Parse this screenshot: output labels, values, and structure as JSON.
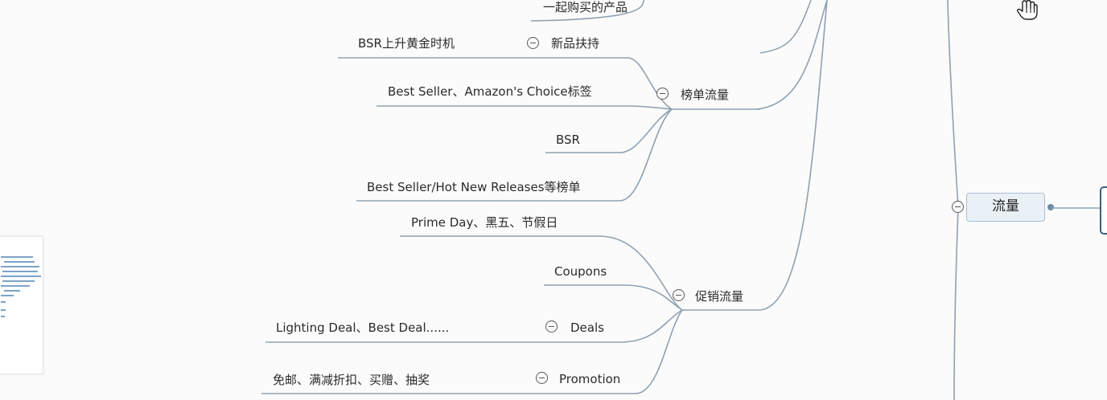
{
  "root": {
    "label": "流量"
  },
  "nodes": {
    "buy_together": "一起购买的产品",
    "bsr_golden": "BSR上升黄金时机",
    "new_support": "新品扶持",
    "ranking_traffic": "榜单流量",
    "best_seller_choice": "Best Seller、Amazon's Choice标签",
    "bsr": "BSR",
    "best_seller_lists": "Best Seller/Hot New Releases等榜单",
    "prime_day": "Prime Day、黑五、节假日",
    "coupons": "Coupons",
    "promo_traffic": "促销流量",
    "lighting_deal": "Lighting Deal、Best Deal......",
    "deals": "Deals",
    "free_shipping": "免邮、满减折扣、买赠、抽奖",
    "promotion": "Promotion"
  },
  "icons": {
    "collapse": "collapse-minus-icon",
    "cursor": "hand-cursor-icon"
  },
  "colors": {
    "link": "#8fa1b1",
    "root_fill": "#e9f0f6",
    "root_border": "#a9bfd1",
    "central_border": "#3d5f7e"
  }
}
